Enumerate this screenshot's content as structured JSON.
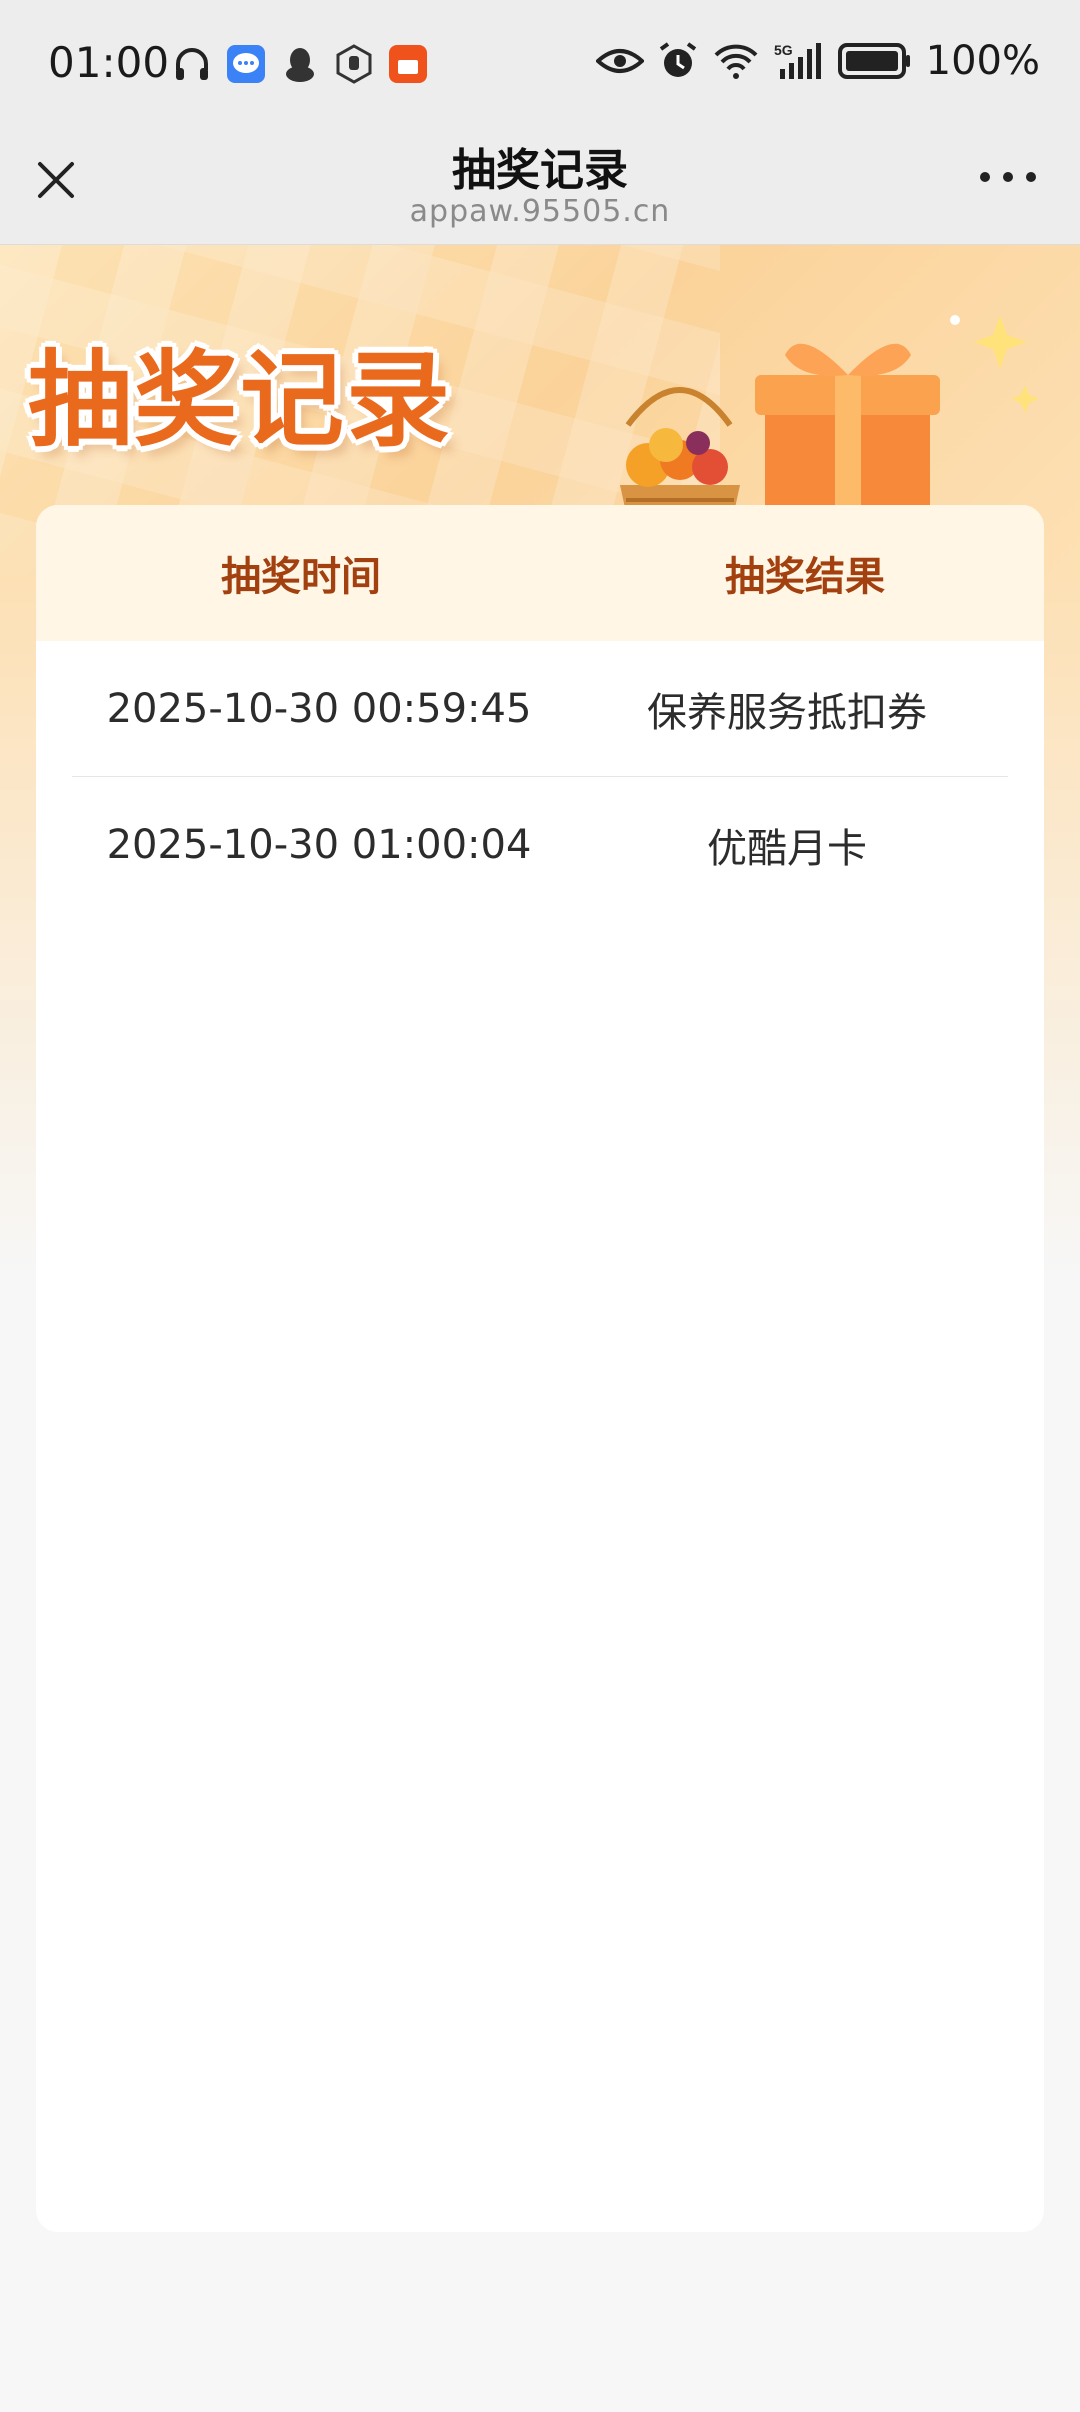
{
  "status_bar": {
    "time": "01:00",
    "battery_percent": "100%",
    "network": "5G",
    "icons_left": [
      "headphones-icon",
      "chat-app-icon",
      "qq-penguin-icon",
      "hand-app-icon",
      "shopping-app-icon"
    ],
    "icons_right": [
      "eye-icon",
      "alarm-icon",
      "wifi-icon",
      "signal-icon",
      "battery-icon"
    ]
  },
  "nav": {
    "title": "抽奖记录",
    "url": "appaw.95505.cn"
  },
  "banner": {
    "title": "抽奖记录"
  },
  "table": {
    "headers": {
      "time": "抽奖时间",
      "result": "抽奖结果"
    },
    "rows": [
      {
        "time": "2025-10-30 00:59:45",
        "result": "保养服务抵扣券"
      },
      {
        "time": "2025-10-30 01:00:04",
        "result": "优酷月卡"
      }
    ]
  },
  "colors": {
    "header_text": "#a3400f",
    "header_bg": "#fff6e5",
    "banner_title": "#ea6a1d"
  }
}
